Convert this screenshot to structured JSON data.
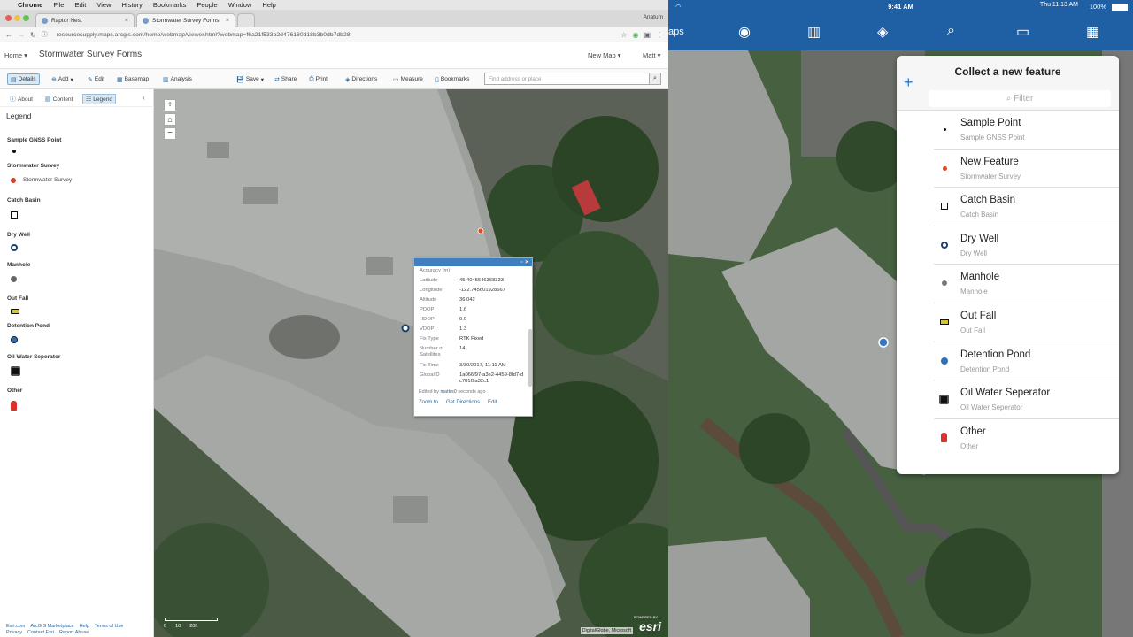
{
  "menubar": {
    "app": "Chrome",
    "items": [
      "File",
      "Edit",
      "View",
      "History",
      "Bookmarks",
      "People",
      "Window",
      "Help"
    ]
  },
  "browser": {
    "tabs": [
      "Raptor Nest",
      "Stormwater Survey Forms"
    ],
    "user": "Anatum",
    "url": "resourcesupply.maps.arcgis.com/home/webmap/viewer.html?webmap=f6a21f533b2d476180d18b3b0db7db28"
  },
  "header": {
    "home": "Home ▾",
    "title": "Stormwater Survey Forms",
    "new_map": "New Map ▾",
    "user": "Matt ▾"
  },
  "toolbar": {
    "details": "Details",
    "add": "Add",
    "edit": "Edit",
    "basemap": "Basemap",
    "analysis": "Analysis",
    "save": "Save",
    "share": "Share",
    "print": "Print",
    "directions": "Directions",
    "measure": "Measure",
    "bookmarks": "Bookmarks",
    "search_placeholder": "Find address or place"
  },
  "sidebar": {
    "tabs": {
      "about": "About",
      "content": "Content",
      "legend": "Legend"
    },
    "legend_title": "Legend",
    "groups": [
      {
        "title": "Sample GNSS Point",
        "sub": ""
      },
      {
        "title": "Stormwater Survey",
        "sub": "Stormwater Survey"
      },
      {
        "title": "Catch Basin",
        "sub": ""
      },
      {
        "title": "Dry Well",
        "sub": ""
      },
      {
        "title": "Manhole",
        "sub": ""
      },
      {
        "title": "Out Fall",
        "sub": ""
      },
      {
        "title": "Detention Pond",
        "sub": ""
      },
      {
        "title": "Oil Water Seperator",
        "sub": ""
      },
      {
        "title": "Other",
        "sub": ""
      }
    ],
    "footer1": [
      "Esri.com",
      "ArcGIS Marketplace",
      "Help",
      "Terms of Use"
    ],
    "footer2": [
      "Privacy",
      "Contact Esri",
      "Report Abuse"
    ]
  },
  "map": {
    "scale_labels": [
      "0",
      "10",
      "20ft"
    ],
    "attribution": "DigitalGlobe, Microsoft",
    "esri_powered": "POWERED BY",
    "esri": "esri"
  },
  "popup": {
    "rows": [
      {
        "k": "Accuracy (m)",
        "v": ""
      },
      {
        "k": "Latitude",
        "v": "45.4045546368333"
      },
      {
        "k": "Longitude",
        "v": "-122.745601928667"
      },
      {
        "k": "Altitude",
        "v": "36.042"
      },
      {
        "k": "PDOP",
        "v": "1.6"
      },
      {
        "k": "HDOP",
        "v": "0.9"
      },
      {
        "k": "VDOP",
        "v": "1.3"
      },
      {
        "k": "Fix Type",
        "v": "RTK Fixed"
      },
      {
        "k": "Number of Satellites",
        "v": "14"
      },
      {
        "k": "Fix Time",
        "v": "3/30/2017, 11:11 AM"
      },
      {
        "k": "GlobalID",
        "v": "1a066f97-a3e2-4459-8fd7-dc781f9a32c1"
      }
    ],
    "edited_prefix": "Edited by",
    "edited_user": "mattrs0",
    "edited_suffix": "seconds ago",
    "actions": [
      "Zoom to",
      "Get Directions",
      "Edit"
    ]
  },
  "ipad": {
    "time": "9:41 AM",
    "clock": "Thu 11:13 AM",
    "battery": "100%",
    "maps_label": "aps",
    "panel_title": "Collect a new feature",
    "filter_placeholder": "Filter",
    "features": [
      {
        "name": "Sample Point",
        "sub": "Sample GNSS Point"
      },
      {
        "name": "New Feature",
        "sub": "Stormwater Survey"
      },
      {
        "name": "Catch Basin",
        "sub": "Catch Basin"
      },
      {
        "name": "Dry Well",
        "sub": "Dry Well"
      },
      {
        "name": "Manhole",
        "sub": "Manhole"
      },
      {
        "name": "Out Fall",
        "sub": "Out Fall"
      },
      {
        "name": "Detention Pond",
        "sub": "Detention Pond"
      },
      {
        "name": "Oil Water Seperator",
        "sub": "Oil Water Seperator"
      },
      {
        "name": "Other",
        "sub": "Other"
      }
    ]
  },
  "colors": {
    "accent": "#1f5fa3",
    "orange_point": "#e0491a",
    "detention": "#2f6fb3",
    "other": "#d9302c"
  }
}
